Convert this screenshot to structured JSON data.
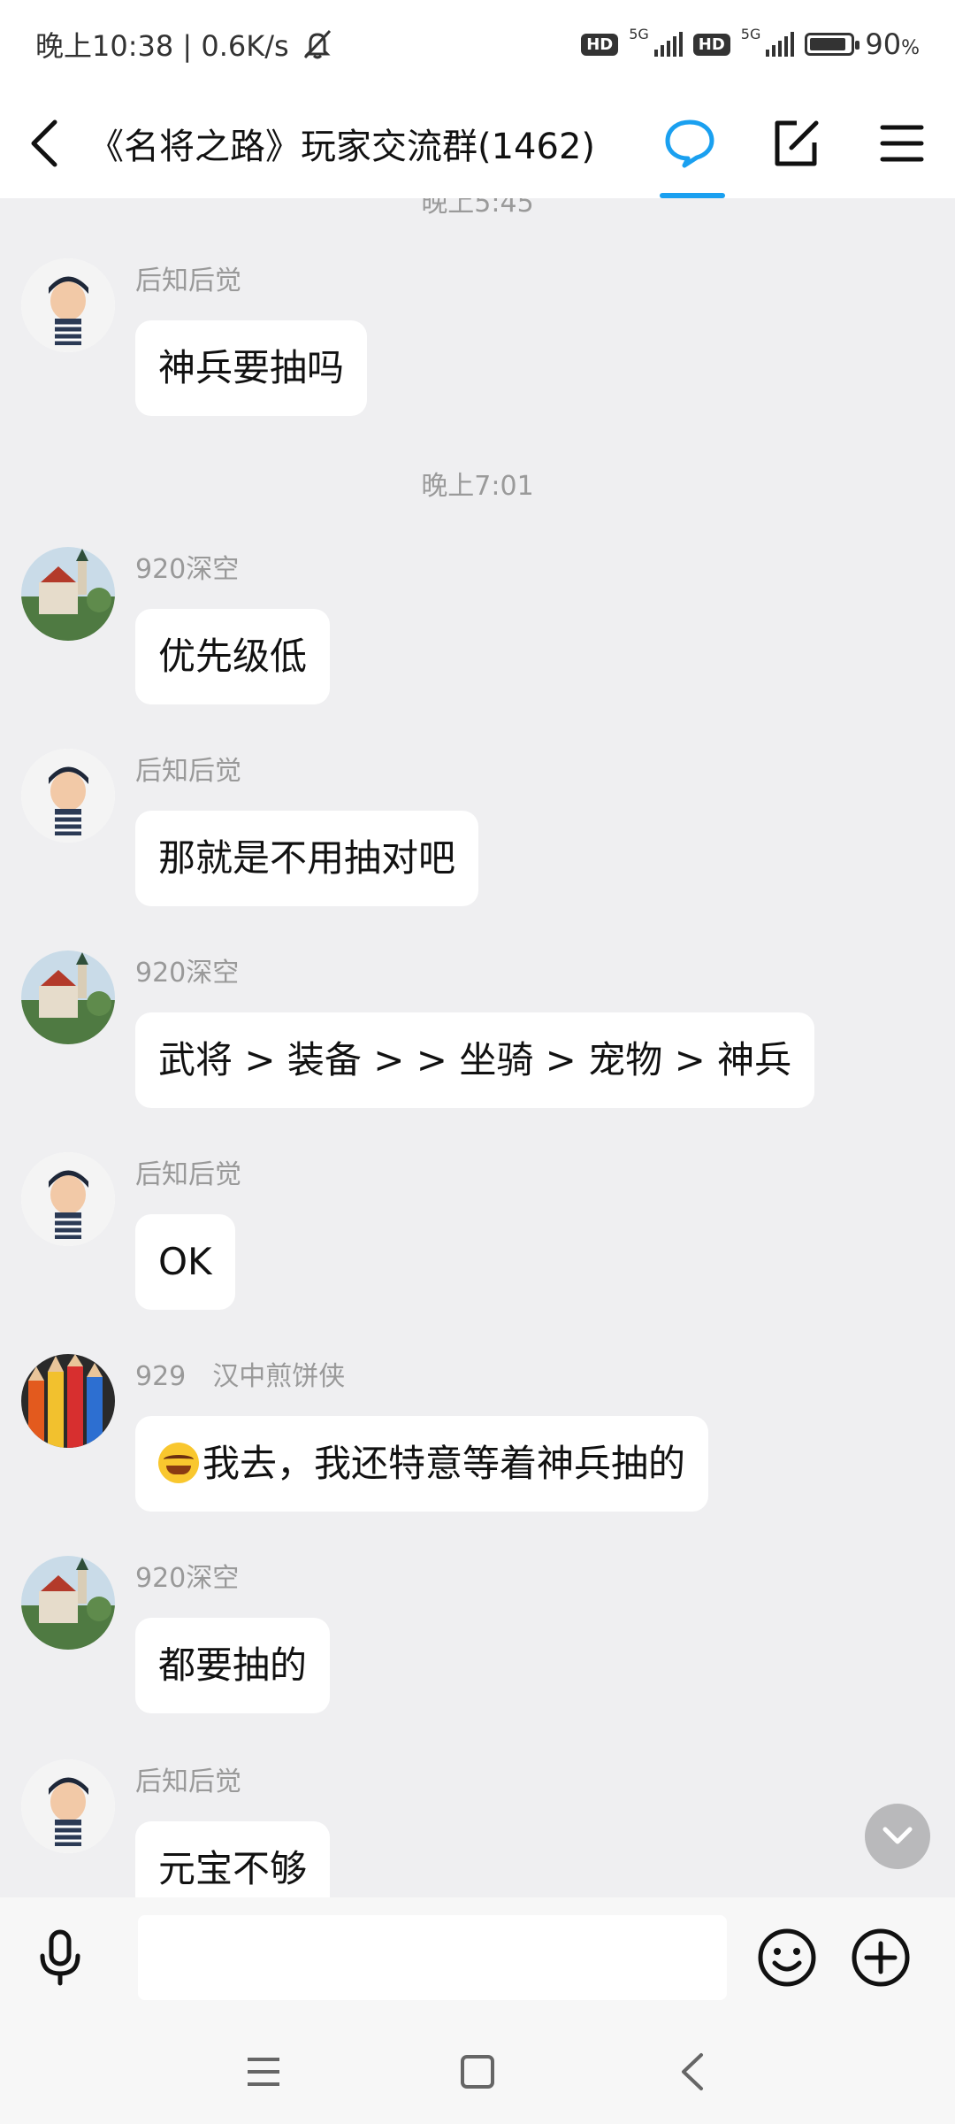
{
  "status_bar": {
    "time_speed": "晚上10:38 | 0.6K/s",
    "network_1": "HD",
    "gen_1": "5G",
    "network_2": "HD",
    "gen_2": "5G",
    "battery": "90",
    "battery_level": 0.9,
    "battery_unit": "%"
  },
  "header": {
    "title": "《名将之路》玩家交流群(1462)"
  },
  "chat": {
    "timestamps": [
      "晚上5:45",
      "晚上7:01"
    ],
    "messages": [
      {
        "sender": "后知后觉",
        "text": "神兵要抽吗"
      },
      {
        "sender": "920深空",
        "text": "优先级低"
      },
      {
        "sender": "后知后觉",
        "text": "那就是不用抽对吧"
      },
      {
        "sender": "920深空",
        "text": "武将 > 装备 > > 坐骑 > 宠物 > 神兵"
      },
      {
        "sender": "后知后觉",
        "text": "OK"
      },
      {
        "sender": "929",
        "sender_tag": "汉中煎饼侠",
        "text": "我去，我还特意等着神兵抽的"
      },
      {
        "sender": "920深空",
        "text": "都要抽的"
      },
      {
        "sender": "后知后觉",
        "text": "元宝不够"
      }
    ]
  },
  "input": {
    "value": "",
    "placeholder": ""
  },
  "colors": {
    "accent": "#1aa0f0",
    "background": "#efeff1",
    "bubble": "#ffffff"
  },
  "icons": [
    "back-arrow-icon",
    "chat-bubble-icon",
    "edit-icon",
    "menu-icon",
    "microphone-icon",
    "smiley-icon",
    "plus-circle-icon",
    "scroll-down-icon",
    "nav-menu-icon",
    "nav-home-icon",
    "nav-back-icon"
  ]
}
